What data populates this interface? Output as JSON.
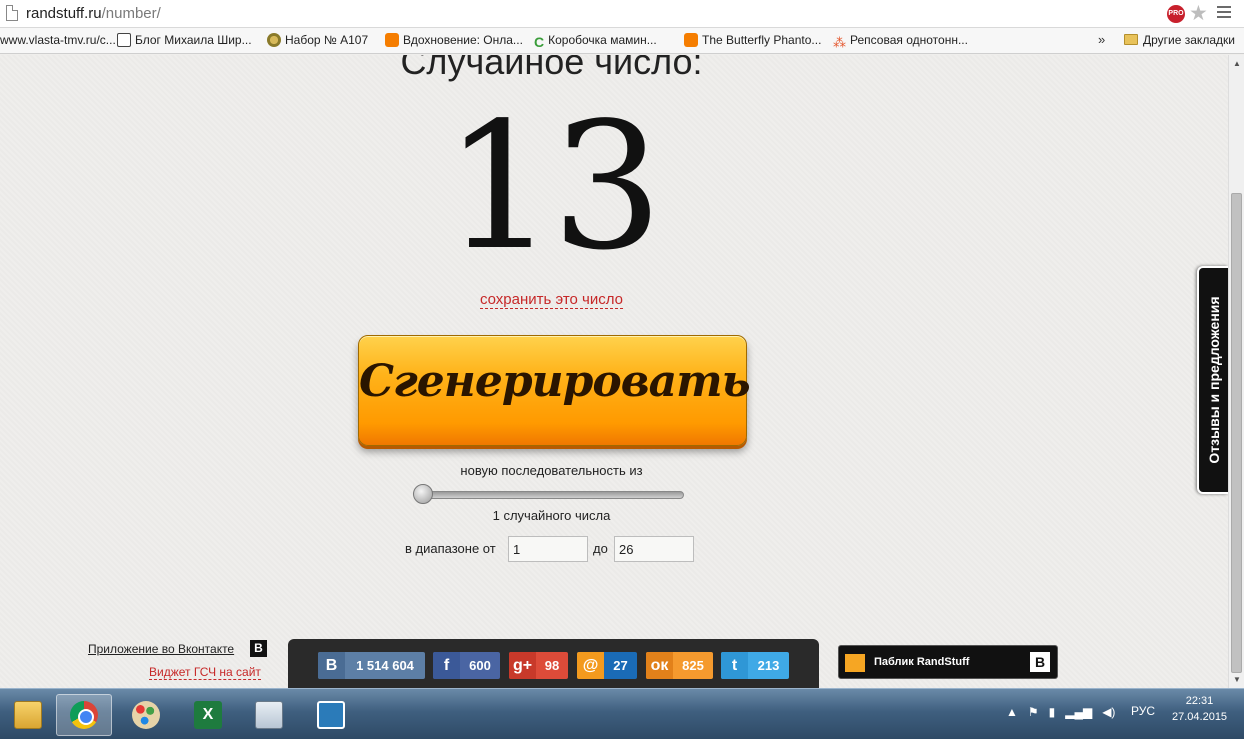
{
  "browser": {
    "url_domain": "randstuff.ru",
    "url_path": "/number/",
    "pro_badge": "PRO",
    "bookmarks": [
      {
        "label": "www.vlasta-tmv.ru/c...",
        "icon": "none"
      },
      {
        "label": "Блог Михаила Шир...",
        "icon": "blog-icon"
      },
      {
        "label": "Набор № А107",
        "icon": "grid-icon"
      },
      {
        "label": "Вдохновение: Онла...",
        "icon": "blogger-icon"
      },
      {
        "label": "Коробочка мамин...",
        "icon": "leaf-icon"
      },
      {
        "label": "The Butterfly Phanto...",
        "icon": "blogger-icon"
      },
      {
        "label": "Репсовая однотонн...",
        "icon": "ribbon-icon"
      }
    ],
    "more": "»",
    "other_bookmarks": "Другие закладки"
  },
  "page": {
    "heading": "Случайное число:",
    "number": "13",
    "save_link": "сохранить это число",
    "generate_button": "Сгенерировать",
    "sequence_label": "новую последовательность из",
    "count_label": "1 случайного числа",
    "range_label": "в диапазоне от",
    "range_from": "1",
    "range_to_label": "до",
    "range_to": "26",
    "slider_value": 1,
    "feedback_tab": "Отзывы и предложения",
    "vk_app_link": "Приложение во Вконтакте",
    "vk_b": "B",
    "widget_link": "Виджет ГСЧ на сайт",
    "public_label": "Паблик RandStuff",
    "public_b": "B"
  },
  "share": [
    {
      "network": "vk",
      "icon": "vk-icon",
      "glyph": "B",
      "count": "1 514 604"
    },
    {
      "network": "facebook",
      "icon": "facebook-icon",
      "glyph": "f",
      "count": "600"
    },
    {
      "network": "google-plus",
      "icon": "google-plus-icon",
      "glyph": "g+",
      "count": "98"
    },
    {
      "network": "mail-ru",
      "icon": "mail-ru-icon",
      "glyph": "@",
      "count": "27"
    },
    {
      "network": "odnoklassniki",
      "icon": "odnoklassniki-icon",
      "glyph": "ок",
      "count": "825"
    },
    {
      "network": "twitter",
      "icon": "twitter-icon",
      "glyph": "t",
      "count": "213"
    }
  ],
  "taskbar": {
    "apps": [
      "explorer",
      "chrome",
      "paint",
      "excel",
      "calculator",
      "photo-viewer"
    ],
    "active_app": "chrome",
    "language": "РУС",
    "time": "22:31",
    "date": "27.04.2015"
  },
  "colors": {
    "button_orange": "#ff9a00",
    "link_red": "#c62828",
    "background": "#efeeec"
  }
}
